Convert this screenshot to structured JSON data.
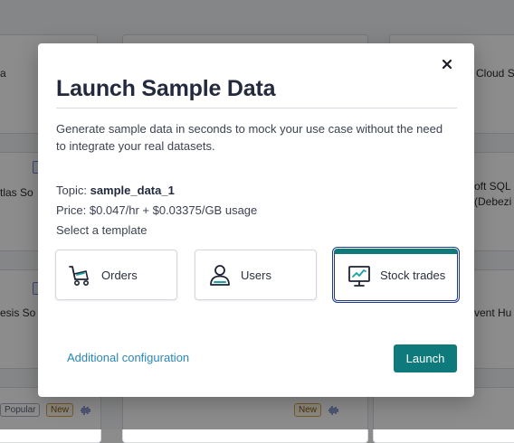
{
  "background": {
    "fragments": {
      "left_top": "a",
      "right_top": "Cloud S",
      "left_mid": "tlas So",
      "right_mid_1": "oft SQL S",
      "right_mid_2": "(Debezi",
      "left_low": "esis So",
      "right_low": "vent Hu"
    },
    "badges": {
      "popular": "Popular",
      "new_left": "New",
      "new_right": "New"
    }
  },
  "modal": {
    "title": "Launch Sample Data",
    "description": "Generate sample data in seconds to mock your use case without the need to integrate your real datasets.",
    "topic_label": "Topic:",
    "topic_value": "sample_data_1",
    "price_label": "Price:",
    "price_value": "$0.047/hr + $0.03375/GB usage",
    "select_label": "Select a template",
    "templates": [
      {
        "label": "Orders",
        "icon": "cart-icon",
        "selected": false
      },
      {
        "label": "Users",
        "icon": "user-icon",
        "selected": false
      },
      {
        "label": "Stock trades",
        "icon": "stock-chart-icon",
        "selected": true
      }
    ],
    "additional_config_label": "Additional configuration",
    "launch_label": "Launch",
    "close_icon": "close-icon"
  },
  "colors": {
    "accent": "#0e7a7b",
    "link": "#2a86b8",
    "selected_border": "#1f3a8a",
    "title": "#242a3e"
  }
}
